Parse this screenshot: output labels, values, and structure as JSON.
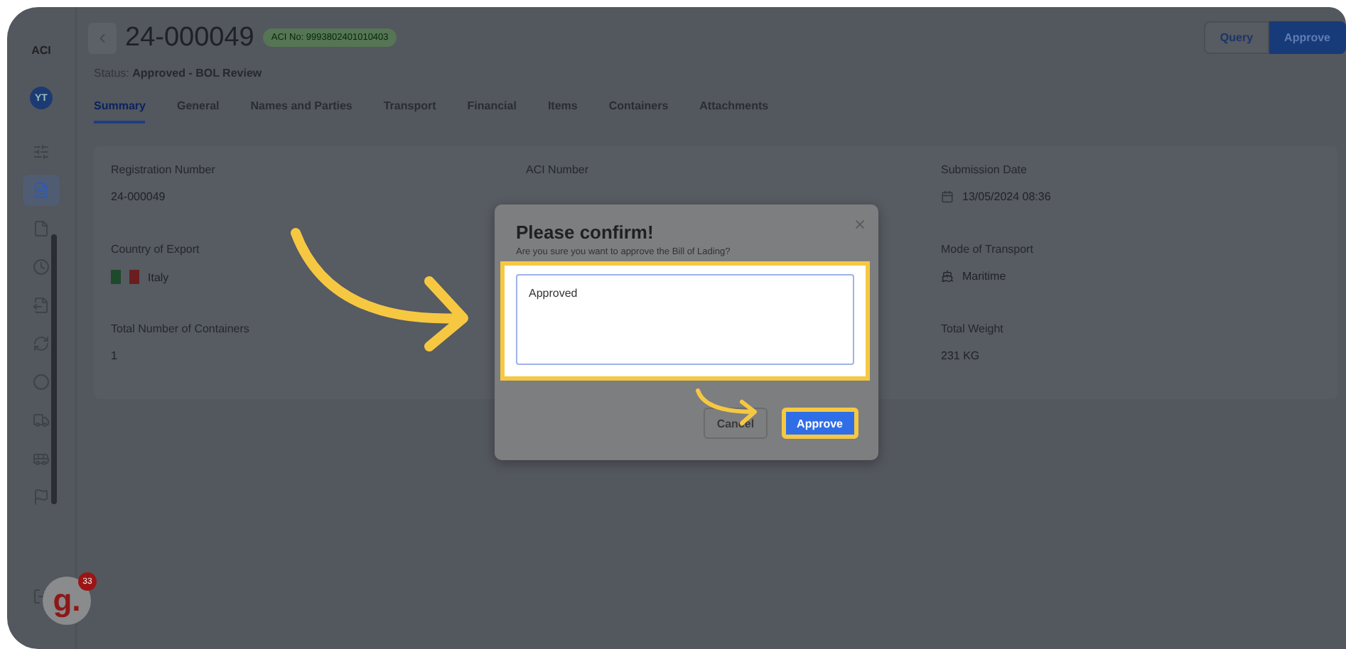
{
  "sidebar": {
    "logo": "ACI",
    "avatar": "YT",
    "nav": [
      {
        "kind": "sliders",
        "selected": false
      },
      {
        "kind": "document",
        "selected": true
      },
      {
        "kind": "file",
        "selected": false
      },
      {
        "kind": "clock",
        "selected": false
      },
      {
        "kind": "export",
        "selected": false
      },
      {
        "kind": "refresh",
        "selected": false
      },
      {
        "kind": "circle",
        "selected": false
      },
      {
        "kind": "truck",
        "selected": false
      },
      {
        "kind": "bus",
        "selected": false
      },
      {
        "kind": "flag",
        "selected": false
      }
    ]
  },
  "header": {
    "title": "24-000049",
    "badge": "ACI No: 9993802401010403",
    "status_label": "Status:",
    "status_value": "Approved - BOL Review",
    "buttons": [
      {
        "label": "Query",
        "kind": "secondary"
      },
      {
        "label": "Approve",
        "kind": "primary"
      }
    ]
  },
  "tabs": [
    {
      "label": "Summary",
      "selected": true
    },
    {
      "label": "General",
      "selected": false
    },
    {
      "label": "Names and Parties",
      "selected": false
    },
    {
      "label": "Transport",
      "selected": false
    },
    {
      "label": "Financial",
      "selected": false
    },
    {
      "label": "Items",
      "selected": false
    },
    {
      "label": "Containers",
      "selected": false
    },
    {
      "label": "Attachments",
      "selected": false
    }
  ],
  "summary": [
    {
      "fields": [
        {
          "label": "Registration Number",
          "value": "24-000049"
        },
        {
          "label": "Country of Export",
          "value": "Italy",
          "kind": "flag"
        },
        {
          "label": "Total Number of Containers",
          "value": "1"
        }
      ]
    },
    {
      "fields": [
        {
          "label": "ACI Number"
        }
      ]
    },
    {
      "fields": [
        {
          "label": "Submission Date",
          "value": "13/05/2024 08:36",
          "kind": "date"
        },
        {
          "label": "Mode of Transport",
          "value": "Maritime",
          "kind": "transport"
        },
        {
          "label": "Total Weight",
          "value": "231 KG"
        }
      ]
    }
  ],
  "dialog": {
    "title": "Please confirm!",
    "message": "Are you sure you want to approve the Bill of Lading?",
    "note": "Approved",
    "buttons": [
      {
        "label": "Cancel",
        "kind": "secondary"
      },
      {
        "label": "Approve",
        "kind": "primary"
      }
    ]
  },
  "help_widget": {
    "letter": "g.",
    "count": "33"
  }
}
